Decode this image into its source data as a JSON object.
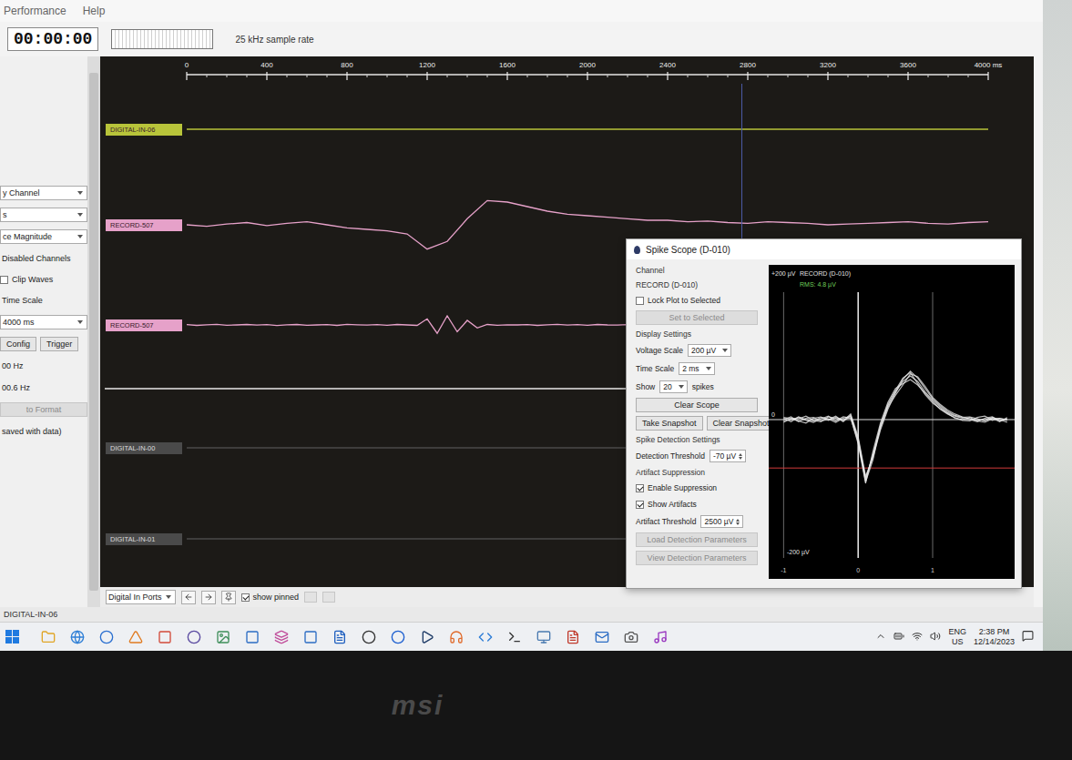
{
  "menu": [
    "Performance",
    "Help"
  ],
  "toolbar": {
    "clock": "00:00:00",
    "sample_rate": "25 kHz sample rate"
  },
  "left_panel": {
    "controls": [
      {
        "kind": "dropdown",
        "label": "y Channel"
      },
      {
        "kind": "dropdown",
        "label": "s"
      },
      {
        "kind": "dropdown",
        "label": "ce Magnitude"
      },
      {
        "kind": "text",
        "label": "Disabled Channels"
      },
      {
        "kind": "checkbox",
        "label": "Clip Waves",
        "checked": false
      },
      {
        "kind": "text",
        "label": "Time Scale"
      },
      {
        "kind": "dropdown",
        "label": "4000 ms"
      },
      {
        "kind": "buttons",
        "labels": [
          "Config",
          "Trigger"
        ]
      },
      {
        "kind": "text",
        "label": "00 Hz"
      },
      {
        "kind": "text",
        "label": "00.6 Hz"
      },
      {
        "kind": "button",
        "label": "to Format",
        "disabled": true
      },
      {
        "kind": "text",
        "label": "saved with data)"
      }
    ]
  },
  "plot": {
    "axis": {
      "ticks": [
        "0",
        "400",
        "800",
        "1200",
        "1600",
        "2000",
        "2400",
        "2800",
        "3200",
        "3600",
        "4000 ms"
      ],
      "max_ms": 4000
    },
    "cursor_ms": 2770,
    "channels": [
      {
        "kind": "digital",
        "label": "DIGITAL-IN-06",
        "color": "#b8c43a"
      },
      {
        "kind": "analog",
        "label": "RECORD-507",
        "color": "#e6a1c9",
        "step_ms": 100,
        "range_uv": 300,
        "values": [
          0,
          -10,
          5,
          15,
          -5,
          10,
          20,
          0,
          -20,
          -30,
          -40,
          -60,
          -160,
          -110,
          40,
          160,
          150,
          120,
          90,
          70,
          60,
          50,
          40,
          30,
          30,
          20,
          25,
          15,
          10,
          20,
          15,
          10,
          0,
          5,
          10,
          15,
          20,
          10,
          5,
          15,
          20
        ]
      },
      {
        "kind": "analog",
        "label": "RECORD-507",
        "color": "#e6a1c9",
        "step_ms": 50,
        "range_uv": 300,
        "values": [
          2,
          -3,
          1,
          4,
          -2,
          0,
          3,
          -1,
          2,
          -4,
          1,
          3,
          -2,
          0,
          2,
          -3,
          4,
          1,
          -1,
          2,
          -2,
          3,
          0,
          -3,
          40,
          -55,
          60,
          -45,
          30,
          -20,
          3,
          -2,
          1,
          0,
          2,
          -3,
          1,
          4,
          -1,
          2,
          -2,
          3,
          0,
          -1,
          2,
          1,
          -3,
          2,
          0,
          4,
          -2,
          1,
          3,
          -1,
          0,
          2,
          -3,
          1,
          2,
          -2,
          0,
          3,
          -1,
          2,
          1,
          -2,
          4,
          0,
          -3,
          1,
          2,
          -1,
          3,
          0,
          -2,
          1,
          2,
          -3,
          0,
          1,
          2
        ]
      },
      {
        "kind": "line",
        "color": "#e8e8e8"
      },
      {
        "kind": "digital",
        "label": "DIGITAL-IN-00",
        "color": "#4a4a4a"
      },
      {
        "kind": "digital",
        "label": "DIGITAL-IN-01",
        "color": "#4a4a4a"
      }
    ],
    "footer": {
      "port_select": "Digital In Ports",
      "show_pinned": {
        "label": "show pinned",
        "checked": true
      }
    }
  },
  "spike_scope": {
    "title": "Spike Scope (D-010)",
    "channel_heading": "Channel",
    "channel": "RECORD (D-010)",
    "lock": {
      "label": "Lock Plot to Selected",
      "checked": false
    },
    "set_button": {
      "label": "Set to Selected",
      "disabled": true
    },
    "display_heading": "Display Settings",
    "voltage_scale": {
      "label": "Voltage Scale",
      "value": "200 µV"
    },
    "time_scale": {
      "label": "Time Scale",
      "value": "2 ms"
    },
    "show": {
      "label": "Show",
      "value": "20",
      "suffix": "spikes"
    },
    "clear_scope": "Clear Scope",
    "take_snapshot": "Take Snapshot",
    "clear_snapshot": "Clear Snapshot",
    "detection_heading": "Spike Detection Settings",
    "detection_threshold": {
      "label": "Detection Threshold",
      "value": "-70 µV"
    },
    "artifact_heading": "Artifact Suppression",
    "enable_suppression": {
      "label": "Enable Suppression",
      "checked": true
    },
    "show_artifacts": {
      "label": "Show Artifacts",
      "checked": true
    },
    "artifact_threshold": {
      "label": "Artifact Threshold",
      "value": "2500 µV"
    },
    "load_params": {
      "label": "Load Detection Parameters",
      "disabled": true
    },
    "view_params": {
      "label": "View Detection Parameters",
      "disabled": true
    },
    "plot": {
      "title": "RECORD (D-010)",
      "rms": "RMS: 4.8 µV",
      "y_top": "+200 µV",
      "y_zero": "0",
      "y_bottom": "-200 µV",
      "x_ticks": [
        "-1",
        "0",
        "1"
      ],
      "range_uv": 200,
      "threshold_uv": -70,
      "t_start_ms": -1,
      "t_step_ms": 0.1,
      "waveforms": [
        [
          2,
          -3,
          4,
          0,
          -2,
          3,
          1,
          -4,
          2,
          5,
          -30,
          -88,
          -50,
          -10,
          20,
          40,
          55,
          63,
          55,
          40,
          28,
          18,
          10,
          5,
          2,
          0,
          -3,
          2,
          4,
          -2,
          1
        ],
        [
          -4,
          2,
          1,
          5,
          -1,
          -3,
          4,
          2,
          -2,
          8,
          -25,
          -82,
          -55,
          -15,
          15,
          38,
          58,
          70,
          60,
          45,
          30,
          20,
          12,
          6,
          3,
          4,
          1,
          -2,
          3,
          0,
          -4
        ],
        [
          3,
          1,
          -2,
          -5,
          2,
          4,
          -1,
          3,
          0,
          3,
          -35,
          -92,
          -46,
          -5,
          25,
          45,
          52,
          58,
          50,
          38,
          26,
          15,
          8,
          3,
          -1,
          -2,
          3,
          5,
          -1,
          2,
          0
        ],
        [
          0,
          4,
          -3,
          2,
          3,
          -2,
          0,
          5,
          -3,
          6,
          -28,
          -85,
          -52,
          -12,
          18,
          35,
          50,
          66,
          62,
          48,
          32,
          22,
          14,
          8,
          4,
          1,
          -1,
          0,
          2,
          -3,
          3
        ],
        [
          -2,
          0,
          3,
          -1,
          -4,
          1,
          5,
          -2,
          4,
          2,
          -32,
          -90,
          -58,
          -8,
          22,
          42,
          60,
          68,
          52,
          36,
          24,
          16,
          9,
          2,
          0,
          3,
          -2,
          -4,
          1,
          2,
          -1
        ]
      ]
    }
  },
  "status_bar": "DIGITAL-IN-06",
  "taskbar": {
    "lang": "ENG",
    "region": "US",
    "time": "2:38 PM",
    "date": "12/14/2023"
  },
  "bezel": {
    "logo": "msi"
  }
}
